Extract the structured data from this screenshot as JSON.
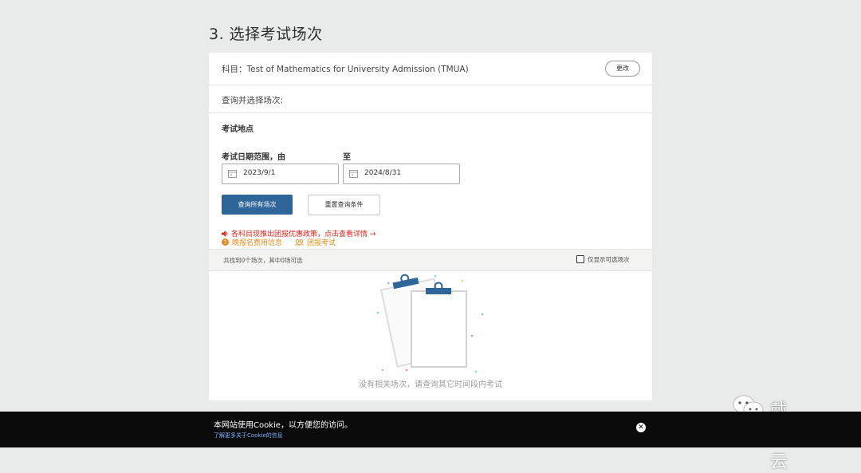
{
  "section": {
    "title": "3. 选择考试场次"
  },
  "subject": {
    "label": "科目：Test of Mathematics for University Admission (TMUA)",
    "change_button": "更改"
  },
  "query": {
    "label": "查询并选择场次:"
  },
  "filters": {
    "location_label": "考试地点",
    "date_range_label": "考试日期范围，由",
    "to_label": "至",
    "start_date": "2023/9/1",
    "end_date": "2024/8/31",
    "search_button": "查询所有场次",
    "reset_button": "重置查询条件"
  },
  "promos": {
    "red_icon": "speaker-icon",
    "red_text": "各科目现推出团报优惠政策，点击查看详情 →",
    "late_fee_icon": "question-circle-icon",
    "late_fee_text": "晚报名费用信息",
    "group_icon": "group-icon",
    "group_text": "团报考试"
  },
  "results": {
    "summary": "共找到0个场次，其中0场可选",
    "filter_checkbox_label": "仅显示可选场次",
    "filter_checked": false
  },
  "empty_state": {
    "message": "没有相关场次，请查询其它时间段内考试"
  },
  "cookie": {
    "message": "本网站使用Cookie，以方便您的访问。",
    "link": "了解更多关于Cookie的信息",
    "close_icon": "close-icon"
  },
  "watermark": {
    "text": "戴森云",
    "icon": "wechat-icon"
  },
  "colors": {
    "page_bg": "#e9ebea",
    "primary": "#2f6699",
    "promo_red": "#e0261c",
    "promo_orange": "#e88c1f",
    "cookie_bg": "#0b0b0b",
    "cookie_link": "#7fb2ff"
  }
}
